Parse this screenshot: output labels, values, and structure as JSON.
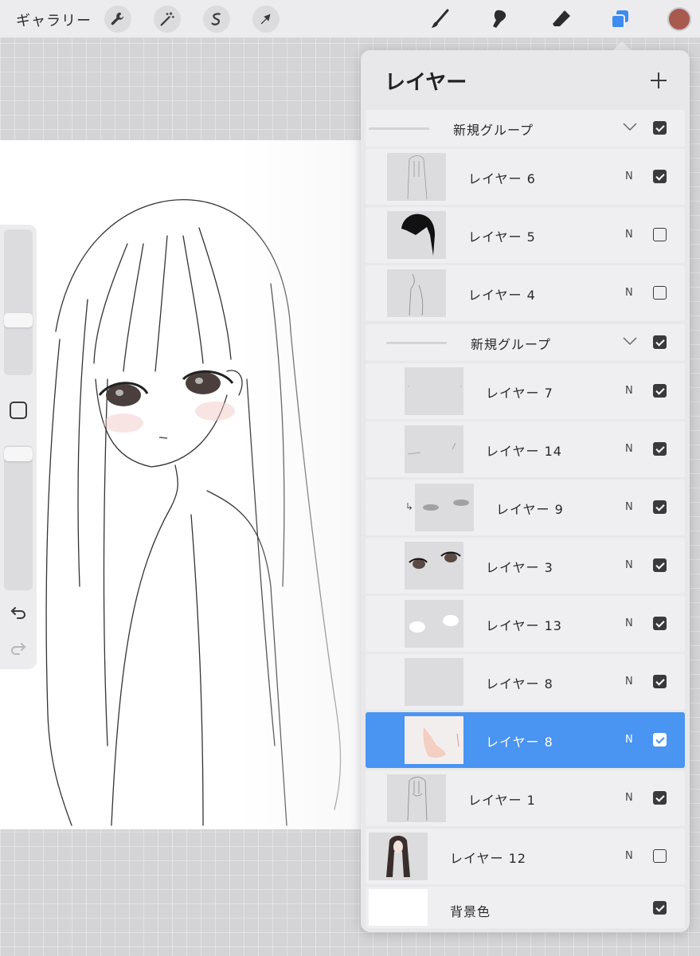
{
  "toolbar": {
    "gallery_label": "ギャラリー",
    "actions": [
      {
        "icon": "wrench-icon"
      },
      {
        "icon": "magic-wand-icon"
      },
      {
        "icon": "selection-icon"
      },
      {
        "icon": "arrow-cursor-icon"
      }
    ],
    "tools": [
      {
        "icon": "brush-icon"
      },
      {
        "icon": "smudge-icon"
      },
      {
        "icon": "eraser-icon"
      },
      {
        "icon": "layers-icon",
        "active": true
      }
    ],
    "current_color": "#a85a4e",
    "accent_color": "#3d8cf0"
  },
  "sidebar": {
    "brush_size_level": 0.22,
    "opacity_level": 0.05
  },
  "layers_panel": {
    "title": "レイヤー",
    "add_icon": "plus-icon",
    "rows": [
      {
        "kind": "group",
        "label": "新規グループ",
        "indent": 0,
        "visible": true
      },
      {
        "kind": "layer",
        "label": "レイヤー 6",
        "blend": "N",
        "indent": 1,
        "visible": true,
        "thumb": "hair-sketch"
      },
      {
        "kind": "layer",
        "label": "レイヤー 5",
        "blend": "N",
        "indent": 1,
        "visible": false,
        "thumb": "black-hair"
      },
      {
        "kind": "layer",
        "label": "レイヤー 4",
        "blend": "N",
        "indent": 1,
        "visible": false,
        "thumb": "body-sketch"
      },
      {
        "kind": "group",
        "label": "新規グループ",
        "indent": 1,
        "visible": true
      },
      {
        "kind": "layer",
        "label": "レイヤー 7",
        "blend": "N",
        "indent": 2,
        "visible": true,
        "thumb": "marks"
      },
      {
        "kind": "layer",
        "label": "レイヤー 14",
        "blend": "N",
        "indent": 2,
        "visible": true,
        "thumb": "lines"
      },
      {
        "kind": "layer",
        "label": "レイヤー 9",
        "blend": "N",
        "indent": 3,
        "visible": true,
        "thumb": "blush",
        "clipped": true
      },
      {
        "kind": "layer",
        "label": "レイヤー 3",
        "blend": "N",
        "indent": 2,
        "visible": true,
        "thumb": "eyes"
      },
      {
        "kind": "layer",
        "label": "レイヤー 13",
        "blend": "N",
        "indent": 2,
        "visible": true,
        "thumb": "white-eyes"
      },
      {
        "kind": "layer",
        "label": "レイヤー 8",
        "blend": "N",
        "indent": 2,
        "visible": true,
        "thumb": "blank"
      },
      {
        "kind": "layer",
        "label": "レイヤー 8",
        "blend": "N",
        "indent": 2,
        "visible": true,
        "thumb": "skin",
        "selected": true
      },
      {
        "kind": "layer",
        "label": "レイヤー 1",
        "blend": "N",
        "indent": 1,
        "visible": true,
        "thumb": "line-art"
      },
      {
        "kind": "layer",
        "label": "レイヤー 12",
        "blend": "N",
        "indent": 0,
        "visible": false,
        "thumb": "silhouette"
      },
      {
        "kind": "background",
        "label": "背景色",
        "indent": 0,
        "visible": true,
        "thumb": "white"
      }
    ]
  }
}
